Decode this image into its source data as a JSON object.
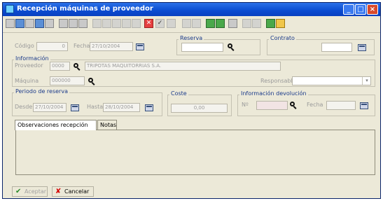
{
  "window": {
    "title": "Recepción máquinas de proveedor",
    "controls": {
      "minimize": "_",
      "maximize": "□",
      "close": "×"
    }
  },
  "toolbar": {
    "icons": [
      "new-icon",
      "save-icon",
      "copy-icon",
      "edit-icon",
      "print-icon",
      "search-icon",
      "find-binoculars-icon",
      "preview-icon",
      "nav-first-icon",
      "nav-prev-icon",
      "nav-next-icon",
      "nav-last-icon",
      "delete-icon",
      "check-icon",
      "tool-icon",
      "grid-icon",
      "grid-alt-icon",
      "filter-icon",
      "filter-alt-icon",
      "refresh-icon",
      "swap-icon",
      "export-icon",
      "excel-icon",
      "folder-icon"
    ],
    "delete_glyph": "✕",
    "check_glyph": "✓"
  },
  "form": {
    "codigo_label": "Código",
    "codigo_value": "0",
    "fecha_label": "Fecha",
    "fecha_value": "27/10/2004",
    "reserva_label": "Reserva",
    "contrato_label": "Contrato",
    "informacion_label": "Información",
    "proveedor_label": "Proveedor",
    "proveedor_code": "0000",
    "proveedor_name": "TRIPOTAS MAQUITORRIAS S.A.",
    "maquina_label": "Máquina",
    "maquina_value": "000000",
    "responsable_label": "Responsable",
    "periodo_label": "Periodo de reserva",
    "desde_label": "Desde",
    "desde_value": "27/10/2004",
    "hasta_label": "Hasta",
    "hasta_value": "28/10/2004",
    "coste_label": "Coste",
    "coste_value": "0,00",
    "info_devolucion_label": "Información devolución",
    "devolucion_no_label": "Nº",
    "devolucion_fecha_label": "Fecha"
  },
  "tabs": [
    {
      "label": "Observaciones recepción",
      "active": true
    },
    {
      "label": "Notas",
      "active": false
    }
  ],
  "buttons": {
    "aceptar_label": "Aceptar",
    "aceptar_glyph": "✔",
    "cancelar_label": "Cancelar",
    "cancelar_glyph": "✘"
  },
  "colors": {
    "titlebar": "#0a4bd0",
    "window_bg": "#ece9d8",
    "group_label": "#1a3a8a",
    "cancel_icon": "#d40000",
    "accept_icon": "#2a8a2a"
  }
}
